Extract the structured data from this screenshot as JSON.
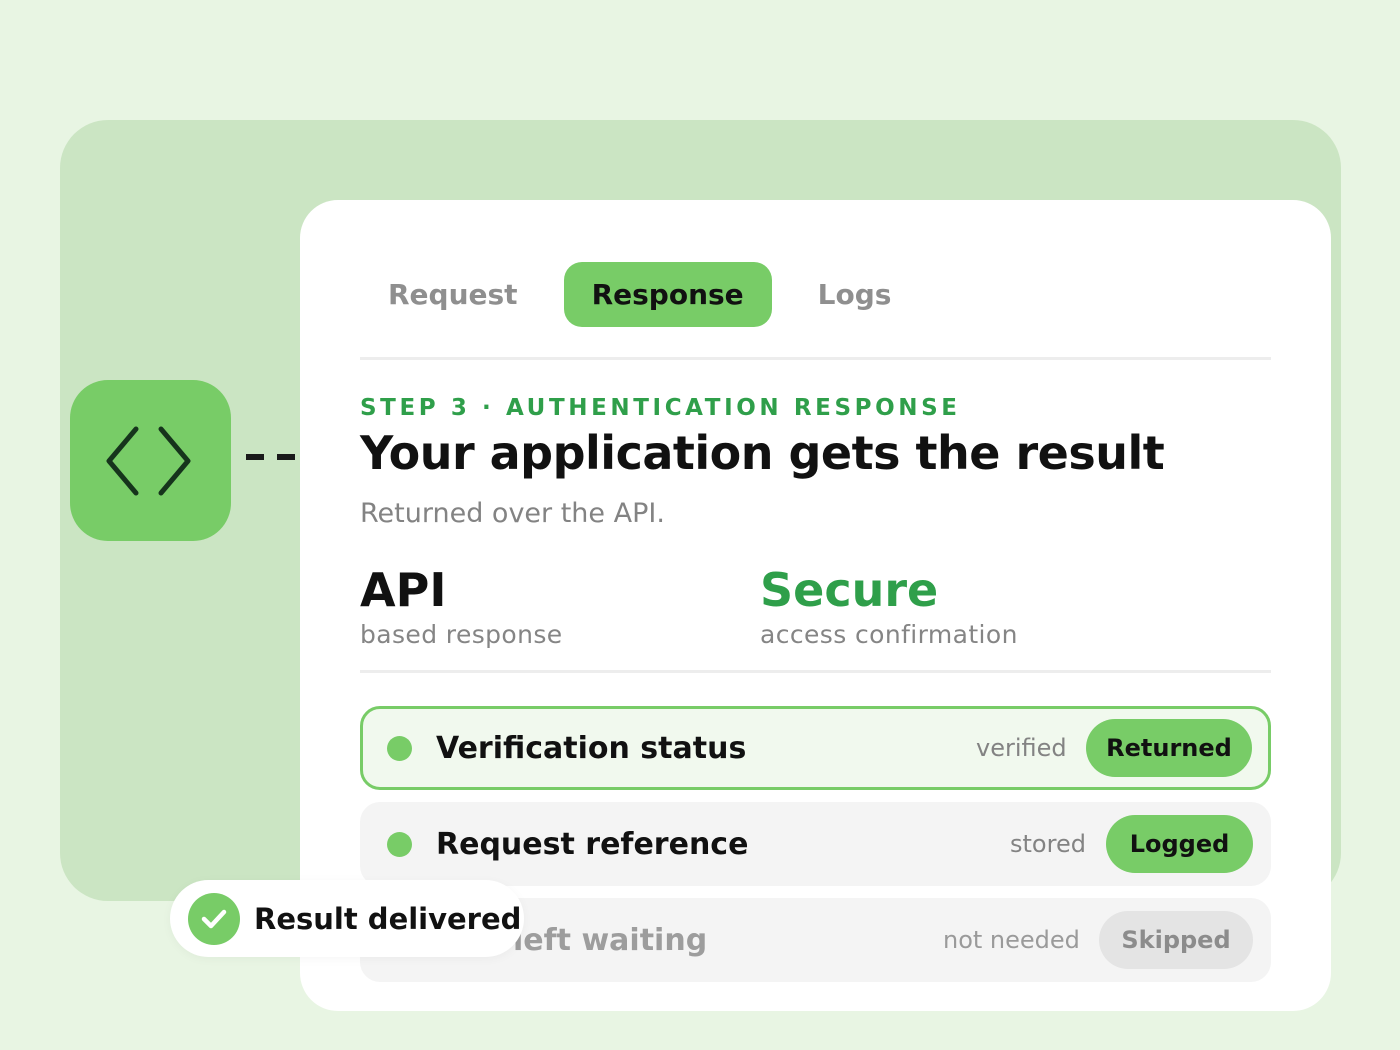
{
  "tabs": [
    {
      "label": "Request",
      "active": false
    },
    {
      "label": "Response",
      "active": true
    },
    {
      "label": "Logs",
      "active": false
    }
  ],
  "header": {
    "eyebrow": "STEP 3 · AUTHENTICATION RESPONSE",
    "title": "Your application gets the result",
    "subtitle": "Returned over the API."
  },
  "stats": [
    {
      "value": "API",
      "caption": "based response",
      "color": "#111111"
    },
    {
      "value": "Secure",
      "caption": "access confirmation",
      "color": "#2f9f4a"
    }
  ],
  "rows": [
    {
      "label": "Verification status",
      "meta": "verified",
      "badge": "Returned",
      "state": "highlight"
    },
    {
      "label": "Request reference",
      "meta": "stored",
      "badge": "Logged",
      "state": "normal"
    },
    {
      "label": "left waiting",
      "meta": "not needed",
      "badge": "Skipped",
      "state": "faded"
    }
  ],
  "toast": {
    "text": "Result delivered",
    "icon": "check-icon"
  },
  "icons": {
    "app_tile": "code-brackets-icon"
  },
  "colors": {
    "accent": "#78cc67",
    "accent_text": "#2f9f4a",
    "backdrop": "#cbe5c3",
    "page_bg": "#e8f5e3"
  }
}
